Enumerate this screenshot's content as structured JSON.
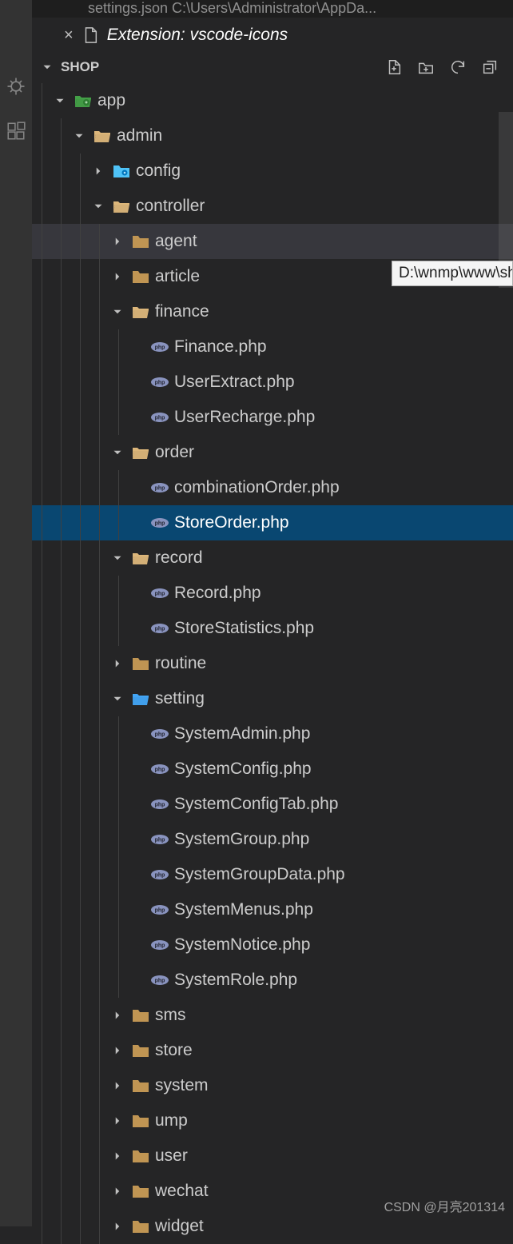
{
  "topbar_fragment": "settings.json   C:\\Users\\Administrator\\AppDa...",
  "tab": {
    "close": "×",
    "label": "Extension: vscode-icons"
  },
  "section": {
    "title": "SHOP"
  },
  "tooltip": "D:\\wnmp\\www\\sho",
  "watermark": "CSDN @月亮201314",
  "tree": [
    {
      "depth": 0,
      "type": "folder-green",
      "expand": "open",
      "label": "app"
    },
    {
      "depth": 1,
      "type": "folder",
      "expand": "open",
      "label": "admin"
    },
    {
      "depth": 2,
      "type": "folder-gear",
      "expand": "closed",
      "label": "config"
    },
    {
      "depth": 2,
      "type": "folder",
      "expand": "open",
      "label": "controller"
    },
    {
      "depth": 3,
      "type": "folder",
      "expand": "closed",
      "label": "agent",
      "hovered": true
    },
    {
      "depth": 3,
      "type": "folder",
      "expand": "closed",
      "label": "article"
    },
    {
      "depth": 3,
      "type": "folder",
      "expand": "open",
      "label": "finance"
    },
    {
      "depth": 4,
      "type": "php",
      "label": "Finance.php"
    },
    {
      "depth": 4,
      "type": "php",
      "label": "UserExtract.php"
    },
    {
      "depth": 4,
      "type": "php",
      "label": "UserRecharge.php"
    },
    {
      "depth": 3,
      "type": "folder",
      "expand": "open",
      "label": "order"
    },
    {
      "depth": 4,
      "type": "php",
      "label": "combinationOrder.php"
    },
    {
      "depth": 4,
      "type": "php",
      "label": "StoreOrder.php",
      "selected": true
    },
    {
      "depth": 3,
      "type": "folder",
      "expand": "open",
      "label": "record"
    },
    {
      "depth": 4,
      "type": "php",
      "label": "Record.php"
    },
    {
      "depth": 4,
      "type": "php",
      "label": "StoreStatistics.php"
    },
    {
      "depth": 3,
      "type": "folder",
      "expand": "closed",
      "label": "routine"
    },
    {
      "depth": 3,
      "type": "folder-blue",
      "expand": "open",
      "label": "setting"
    },
    {
      "depth": 4,
      "type": "php",
      "label": "SystemAdmin.php"
    },
    {
      "depth": 4,
      "type": "php",
      "label": "SystemConfig.php"
    },
    {
      "depth": 4,
      "type": "php",
      "label": "SystemConfigTab.php"
    },
    {
      "depth": 4,
      "type": "php",
      "label": "SystemGroup.php"
    },
    {
      "depth": 4,
      "type": "php",
      "label": "SystemGroupData.php"
    },
    {
      "depth": 4,
      "type": "php",
      "label": "SystemMenus.php"
    },
    {
      "depth": 4,
      "type": "php",
      "label": "SystemNotice.php"
    },
    {
      "depth": 4,
      "type": "php",
      "label": "SystemRole.php"
    },
    {
      "depth": 3,
      "type": "folder",
      "expand": "closed",
      "label": "sms"
    },
    {
      "depth": 3,
      "type": "folder",
      "expand": "closed",
      "label": "store"
    },
    {
      "depth": 3,
      "type": "folder",
      "expand": "closed",
      "label": "system"
    },
    {
      "depth": 3,
      "type": "folder",
      "expand": "closed",
      "label": "ump"
    },
    {
      "depth": 3,
      "type": "folder",
      "expand": "closed",
      "label": "user"
    },
    {
      "depth": 3,
      "type": "folder",
      "expand": "closed",
      "label": "wechat"
    },
    {
      "depth": 3,
      "type": "folder",
      "expand": "closed",
      "label": "widget"
    }
  ]
}
